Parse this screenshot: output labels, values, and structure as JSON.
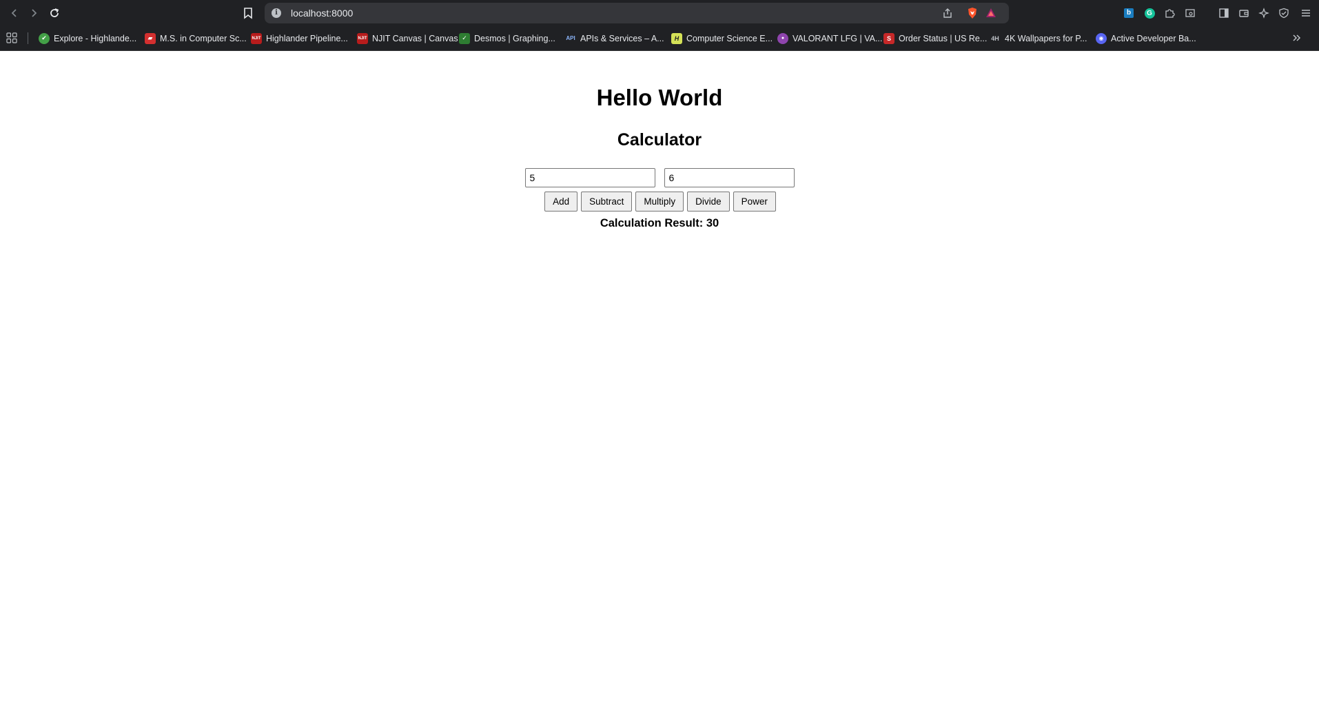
{
  "browser": {
    "url": "localhost:8000",
    "bookmarks": [
      {
        "label": "Explore - Highlande...",
        "icon": "highlander-icon",
        "color": "#4caf50"
      },
      {
        "label": "M.S. in Computer Sc...",
        "icon": "njit-flag-icon",
        "color": "#d32f2f"
      },
      {
        "label": "Highlander Pipeline...",
        "icon": "njit-icon",
        "color": "#b71c1c"
      },
      {
        "label": "NJIT Canvas | Canvas",
        "icon": "njit-icon",
        "color": "#b71c1c"
      },
      {
        "label": "Desmos | Graphing...",
        "icon": "desmos-icon",
        "color": "#2e7d32"
      },
      {
        "label": "APIs & Services – A...",
        "icon": "api-icon",
        "color": "#4285f4"
      },
      {
        "label": "Computer Science E...",
        "icon": "h-icon",
        "color": "#d4e157"
      },
      {
        "label": "VALORANT LFG | VA...",
        "icon": "valorant-lfg-icon",
        "color": "#8e44ad"
      },
      {
        "label": "Order Status | US Re...",
        "icon": "order-status-icon",
        "color": "#c62828"
      },
      {
        "label": "4K Wallpapers for P...",
        "icon": "wallpapers-icon",
        "color": "#202124"
      },
      {
        "label": "Active Developer Ba...",
        "icon": "discord-icon",
        "color": "#5865f2"
      }
    ],
    "bookmark_glyphs": [
      "✔",
      "▰",
      "NJIT",
      "NJIT",
      "✓",
      "API",
      "H",
      "●",
      "S",
      "4H",
      "◉"
    ]
  },
  "page": {
    "heading": "Hello World",
    "subheading": "Calculator",
    "input1": "5",
    "input2": "6",
    "buttons": {
      "add": "Add",
      "subtract": "Subtract",
      "multiply": "Multiply",
      "divide": "Divide",
      "power": "Power"
    },
    "result": "Calculation Result: 30"
  }
}
